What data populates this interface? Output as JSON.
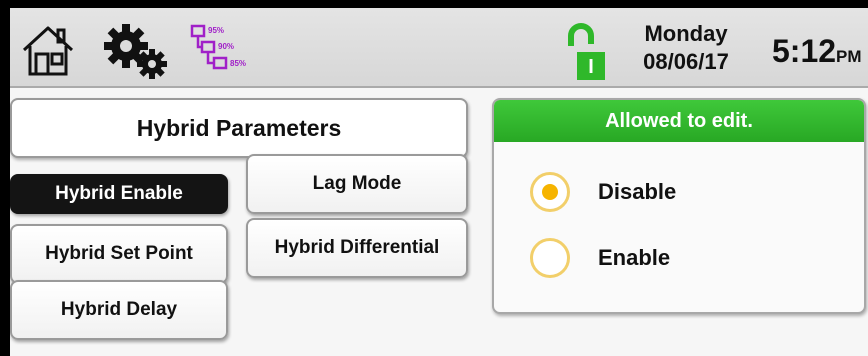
{
  "header": {
    "day": "Monday",
    "date": "08/06/17",
    "time": "5:12",
    "ampm": "PM",
    "icons": [
      "home-icon",
      "gear-icon",
      "hierarchy-tree-icon",
      "unlock-icon"
    ],
    "tree_labels": [
      "95%",
      "90%",
      "85%"
    ],
    "lock_letter": "I",
    "accent_color": "#2fb82a",
    "tree_color": "#a020c8"
  },
  "main": {
    "title": "Hybrid Parameters",
    "buttons": {
      "hybrid_enable": "Hybrid Enable",
      "lag_mode": "Lag Mode",
      "hybrid_set_point": "Hybrid Set Point",
      "hybrid_differential": "Hybrid Differential",
      "hybrid_delay": "Hybrid Delay"
    },
    "selected": "Hybrid Enable"
  },
  "panel": {
    "header": "Allowed to edit.",
    "header_color": "#2fb82a",
    "options": [
      {
        "label": "Disable",
        "selected": true
      },
      {
        "label": "Enable",
        "selected": false
      }
    ]
  }
}
